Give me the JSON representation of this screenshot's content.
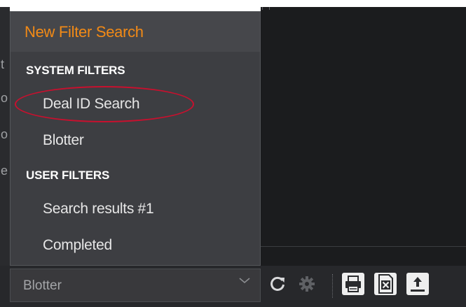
{
  "menu": {
    "new_filter_label": "New Filter Search",
    "system_header": "SYSTEM FILTERS",
    "system_items": [
      {
        "label": "Deal ID Search"
      },
      {
        "label": "Blotter"
      }
    ],
    "user_header": "USER FILTERS",
    "user_items": [
      {
        "label": "Search results #1"
      },
      {
        "label": "Completed"
      }
    ]
  },
  "filter_select": {
    "value": "Blotter"
  },
  "toolbar": {
    "buttons": [
      "refresh-icon",
      "settings-icon",
      "print-icon",
      "export-excel-icon",
      "upload-icon"
    ]
  },
  "colors": {
    "accent_orange": "#f28a16",
    "highlight_red": "#c8102e",
    "menu_bg": "#3d3e42",
    "toolbar_bg": "#27282b"
  }
}
